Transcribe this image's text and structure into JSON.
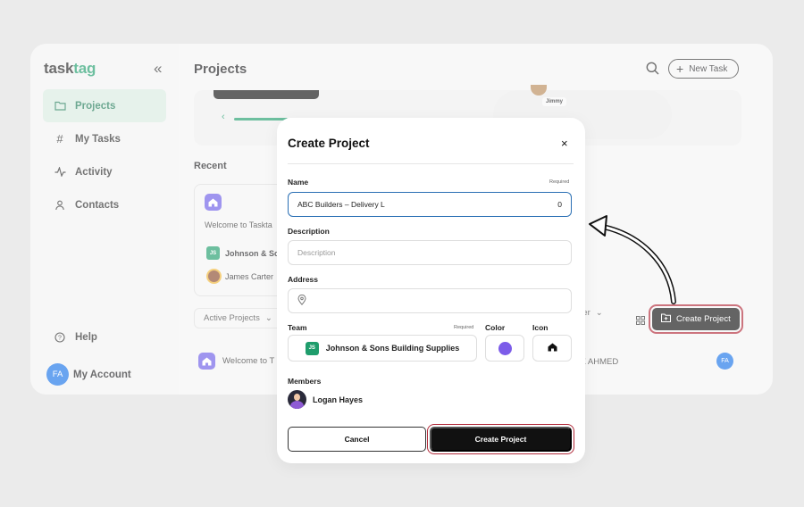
{
  "sidebar": {
    "logo_main": "task",
    "logo_accent": "tag",
    "collapse": "«",
    "items": [
      {
        "label": "Projects",
        "icon": "folder-icon"
      },
      {
        "label": "My Tasks",
        "icon": "hash-icon"
      },
      {
        "label": "Activity",
        "icon": "activity-icon"
      },
      {
        "label": "Contacts",
        "icon": "user-icon"
      }
    ],
    "help": "Help",
    "account_initials": "FA",
    "account": "My Account"
  },
  "header": {
    "title": "Projects",
    "new_task": "New Task"
  },
  "background": {
    "jimmy": "Jimmy",
    "recent": "Recent",
    "welcome": "Welcome to Taskta",
    "team_short": "Johnson & Sc",
    "james": "James Carter",
    "active_projects": "Active Projects",
    "member_dd": "ber",
    "create_project": "Create Project",
    "row_title": "Welcome to T",
    "row_owner": "Z AHMED",
    "row_initials": "FA"
  },
  "modal": {
    "title": "Create Project",
    "close": "×",
    "name_label": "Name",
    "required": "Required",
    "name_value": "ABC Builders – Delivery L",
    "name_count": "0",
    "description_label": "Description",
    "description_placeholder": "Description",
    "address_label": "Address",
    "team_label": "Team",
    "team_required": "Required",
    "team_badge": "JS",
    "team_value": "Johnson & Sons Building Supplies",
    "color_label": "Color",
    "color_value": "#7c5ce9",
    "icon_label": "Icon",
    "members_label": "Members",
    "member_name": "Logan Hayes",
    "cancel": "Cancel",
    "create": "Create Project"
  }
}
